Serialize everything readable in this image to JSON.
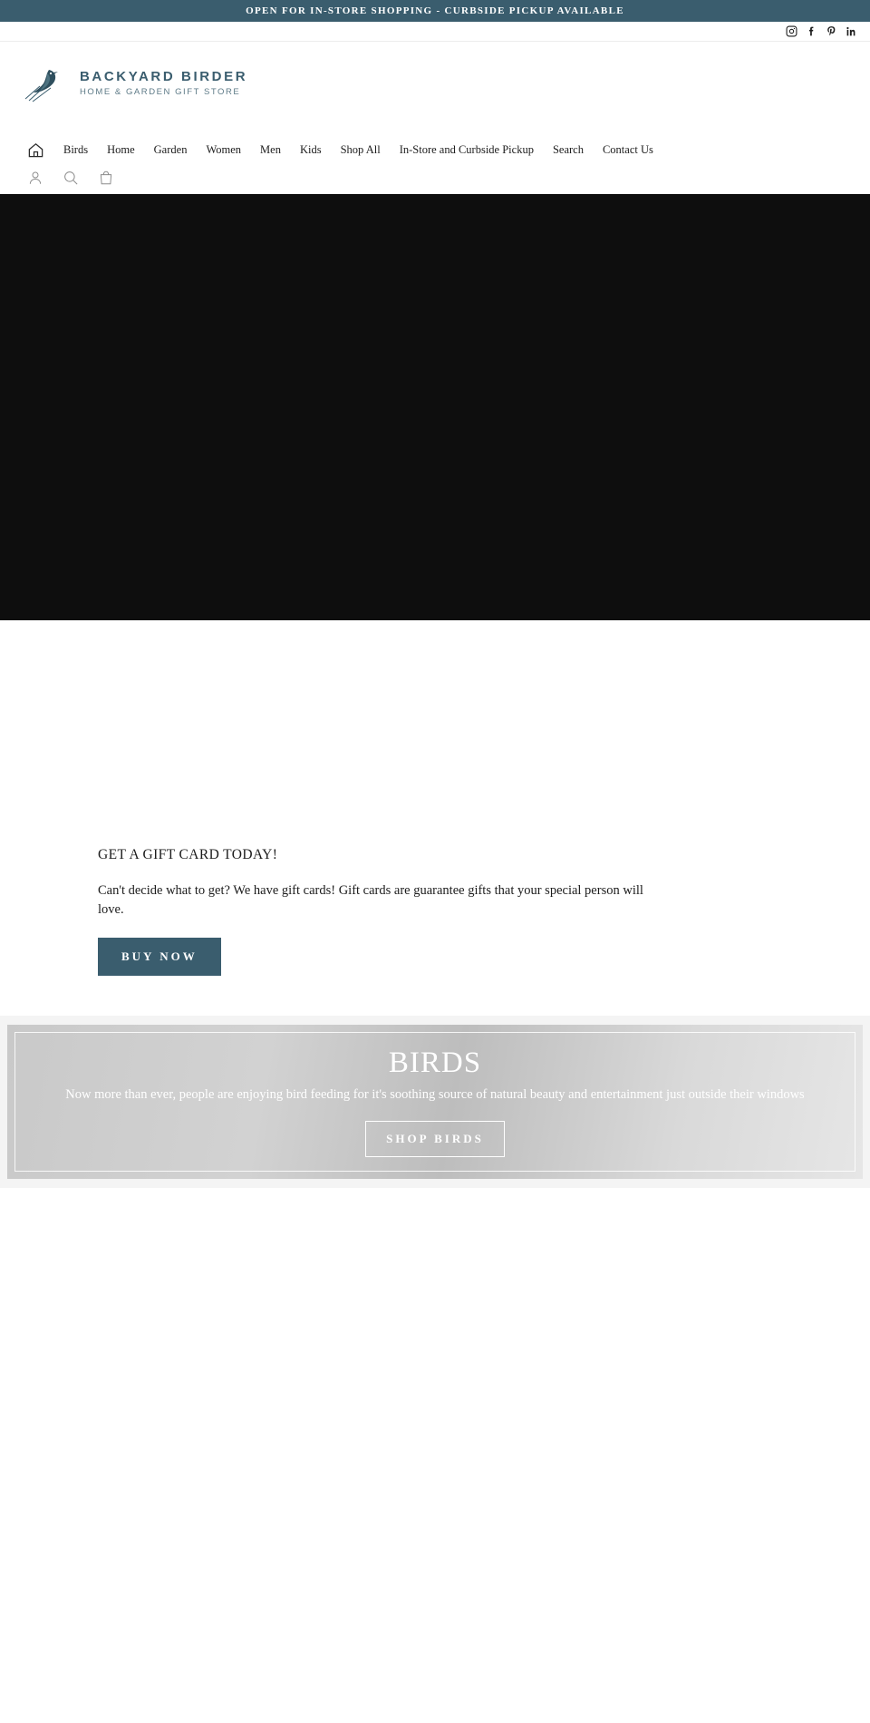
{
  "announcement": {
    "text": "OPEN FOR IN-STORE SHOPPING - CURBSIDE PICKUP AVAILABLE",
    "background_color": "#3A5D6E"
  },
  "social": {
    "items": [
      {
        "name": "instagram-icon",
        "label": "Instagram"
      },
      {
        "name": "facebook-icon",
        "label": "Facebook"
      },
      {
        "name": "pinterest-icon",
        "label": "Pinterest"
      },
      {
        "name": "linkedin-icon",
        "label": "LinkedIn"
      }
    ]
  },
  "header": {
    "brand_name": "BACKYARD BIRDER",
    "brand_tagline": "HOME & GARDEN GIFT STORE",
    "brand_color": "#3A5D6E",
    "logo_icon": "bird-logo-icon"
  },
  "nav": {
    "home_icon": "home-icon",
    "items": [
      {
        "label": "Birds"
      },
      {
        "label": "Home"
      },
      {
        "label": "Garden"
      },
      {
        "label": "Women"
      },
      {
        "label": "Men"
      },
      {
        "label": "Kids"
      },
      {
        "label": "Shop All"
      },
      {
        "label": "In-Store and Curbside Pickup"
      },
      {
        "label": "Search"
      },
      {
        "label": "Contact Us"
      }
    ],
    "utility_icons": [
      {
        "name": "account-icon",
        "label": "Account"
      },
      {
        "name": "search-icon",
        "label": "Search"
      },
      {
        "name": "cart-icon",
        "label": "Cart"
      }
    ]
  },
  "giftcard": {
    "title": "GET A GIFT CARD TODAY!",
    "body": "Can't decide what to get? We have gift cards! Gift cards are guarantee gifts that your special person will love.",
    "button_label": "Buy Now",
    "button_color": "#3A5D6E"
  },
  "collection": {
    "title": "BIRDS",
    "subtitle": "Now more than ever, people are enjoying bird feeding for it's soothing source of natural beauty and entertainment just outside their windows",
    "button_label": "Shop Birds"
  }
}
